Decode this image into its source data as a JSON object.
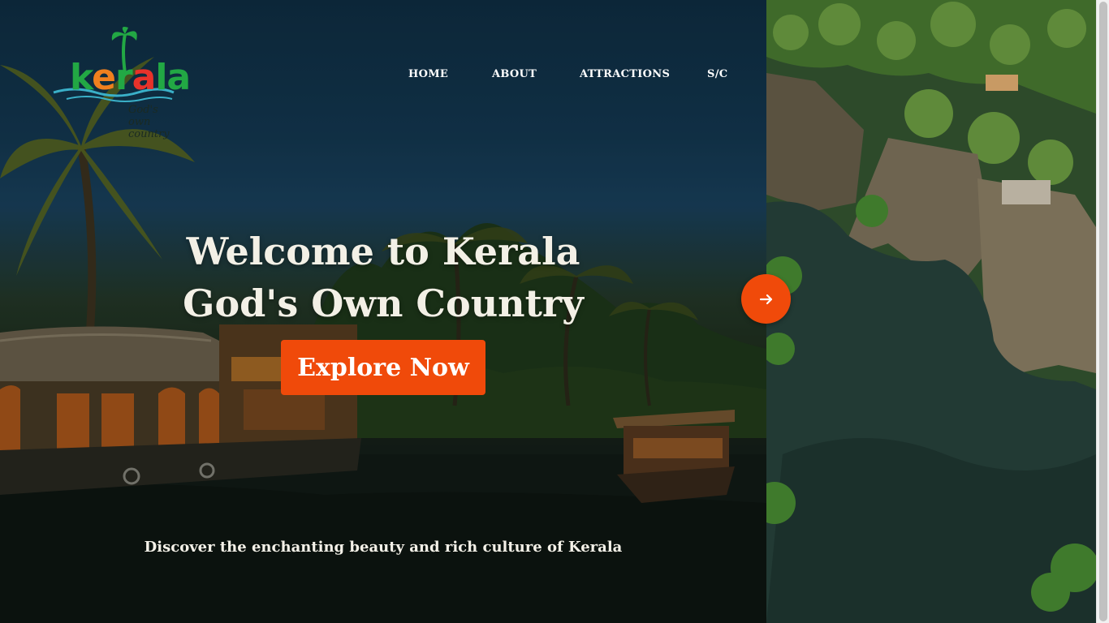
{
  "logo": {
    "wordmark": "kerala",
    "tagline": "God's own country",
    "icon": "palm-tree-icon"
  },
  "nav": {
    "items": [
      {
        "label": "HOME"
      },
      {
        "label": "ABOUT"
      },
      {
        "label": "ATTRACTIONS"
      },
      {
        "label": "S/C"
      }
    ]
  },
  "hero": {
    "title_line1": "Welcome to Kerala",
    "title_line2": "God's Own Country",
    "cta_label": "Explore Now",
    "tagline": "Discover the enchanting beauty and rich culture of Kerala"
  },
  "carousel": {
    "next_icon": "arrow-right-icon"
  },
  "colors": {
    "accent": "#f04a0a",
    "text_light": "#f3f0e6",
    "sky": "#143a54"
  }
}
